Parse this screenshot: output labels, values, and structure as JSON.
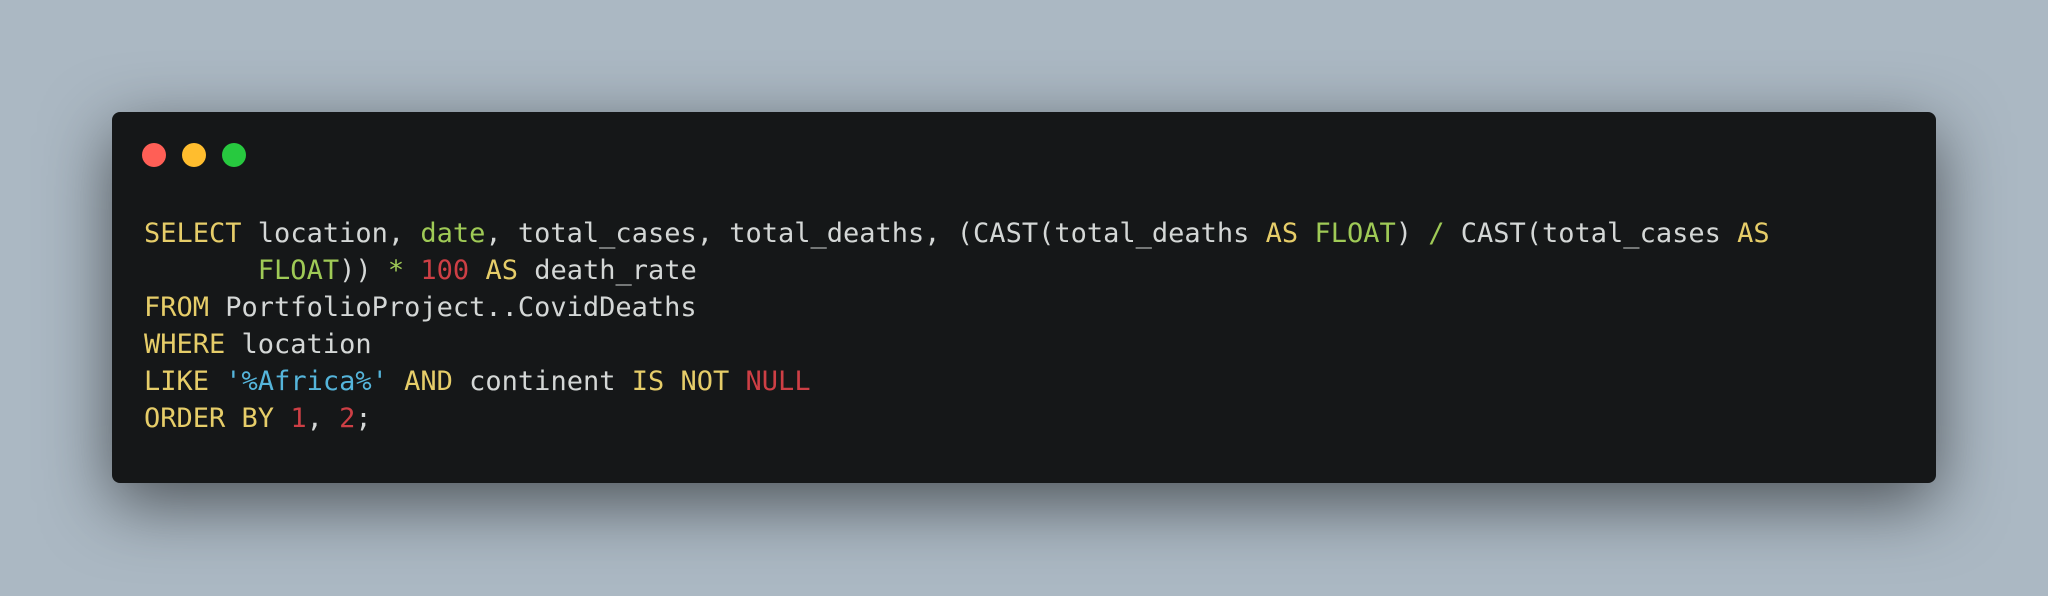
{
  "window": {
    "controls": {
      "close_color": "#ff5f56",
      "minimize_color": "#ffbd2e",
      "maximize_color": "#27c93f"
    }
  },
  "editor": {
    "language": "sql",
    "lines": [
      {
        "tokens": [
          {
            "t": "SELECT",
            "c": "kw"
          },
          {
            "t": " location, ",
            "c": "id"
          },
          {
            "t": "date",
            "c": "ty"
          },
          {
            "t": ", total_cases, total_deaths, (CAST(total_deaths ",
            "c": "id"
          },
          {
            "t": "AS",
            "c": "kw"
          },
          {
            "t": " ",
            "c": "id"
          },
          {
            "t": "FLOAT",
            "c": "ty"
          },
          {
            "t": ") ",
            "c": "id"
          },
          {
            "t": "/",
            "c": "op"
          },
          {
            "t": " CAST(total_cases ",
            "c": "id"
          },
          {
            "t": "AS",
            "c": "kw"
          }
        ]
      },
      {
        "tokens": [
          {
            "t": "       ",
            "c": "id"
          },
          {
            "t": "FLOAT",
            "c": "ty"
          },
          {
            "t": ")) ",
            "c": "id"
          },
          {
            "t": "*",
            "c": "op"
          },
          {
            "t": " ",
            "c": "id"
          },
          {
            "t": "100",
            "c": "num"
          },
          {
            "t": " ",
            "c": "id"
          },
          {
            "t": "AS",
            "c": "kw"
          },
          {
            "t": " death_rate",
            "c": "id"
          }
        ]
      },
      {
        "tokens": [
          {
            "t": "FROM",
            "c": "kw"
          },
          {
            "t": " PortfolioProject..CovidDeaths",
            "c": "id"
          }
        ]
      },
      {
        "tokens": [
          {
            "t": "WHERE",
            "c": "kw"
          },
          {
            "t": " location",
            "c": "id"
          }
        ]
      },
      {
        "tokens": [
          {
            "t": "LIKE",
            "c": "kw"
          },
          {
            "t": " ",
            "c": "id"
          },
          {
            "t": "'%Africa%'",
            "c": "str"
          },
          {
            "t": " ",
            "c": "id"
          },
          {
            "t": "AND",
            "c": "kw"
          },
          {
            "t": " continent ",
            "c": "id"
          },
          {
            "t": "IS",
            "c": "kw"
          },
          {
            "t": " ",
            "c": "id"
          },
          {
            "t": "NOT",
            "c": "kw"
          },
          {
            "t": " ",
            "c": "id"
          },
          {
            "t": "NULL",
            "c": "nul"
          }
        ]
      },
      {
        "tokens": [
          {
            "t": "ORDER",
            "c": "kw"
          },
          {
            "t": " ",
            "c": "id"
          },
          {
            "t": "BY",
            "c": "kw"
          },
          {
            "t": " ",
            "c": "id"
          },
          {
            "t": "1",
            "c": "num"
          },
          {
            "t": ", ",
            "c": "id"
          },
          {
            "t": "2",
            "c": "num"
          },
          {
            "t": ";",
            "c": "id"
          }
        ]
      }
    ]
  }
}
